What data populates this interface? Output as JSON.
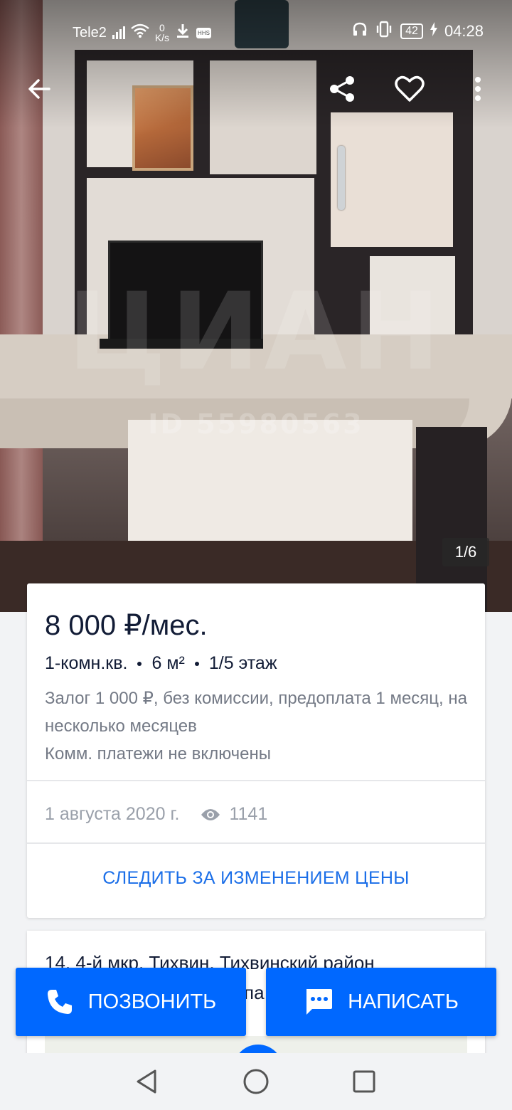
{
  "status_bar": {
    "carrier": "Tele2",
    "speed_value": "0",
    "speed_unit": "K/s",
    "hhs": "HHS",
    "battery": "42",
    "time": "04:28"
  },
  "photo": {
    "watermark": "ЦИАН",
    "watermark_id": "ID 55980563",
    "counter": "1/6"
  },
  "listing": {
    "price": "8 000 ₽/мес.",
    "features": [
      "1-комн.кв.",
      "6 м²",
      "1/5 этаж"
    ],
    "desc_line1": "Залог 1 000 ₽, без комиссии, предоплата 1 месяц, на несколько месяцев",
    "desc_line2": "Комм. платежи не включены",
    "date": "1 августа 2020 г.",
    "views": "1141",
    "follow_label": "СЛЕДИТЬ ЗА ИЗМЕНЕНИЕМ ЦЕНЫ"
  },
  "address": {
    "line1": "14, 4-й мкр, Тихвин, Тихвинский район",
    "line2_partial": "па"
  },
  "actions": {
    "call_label": "ПОЗВОНИТЬ",
    "message_label": "НАПИСАТЬ"
  },
  "colors": {
    "accent": "#0068ff",
    "link": "#1a6ee8",
    "text": "#121c36",
    "muted": "#747a86"
  }
}
